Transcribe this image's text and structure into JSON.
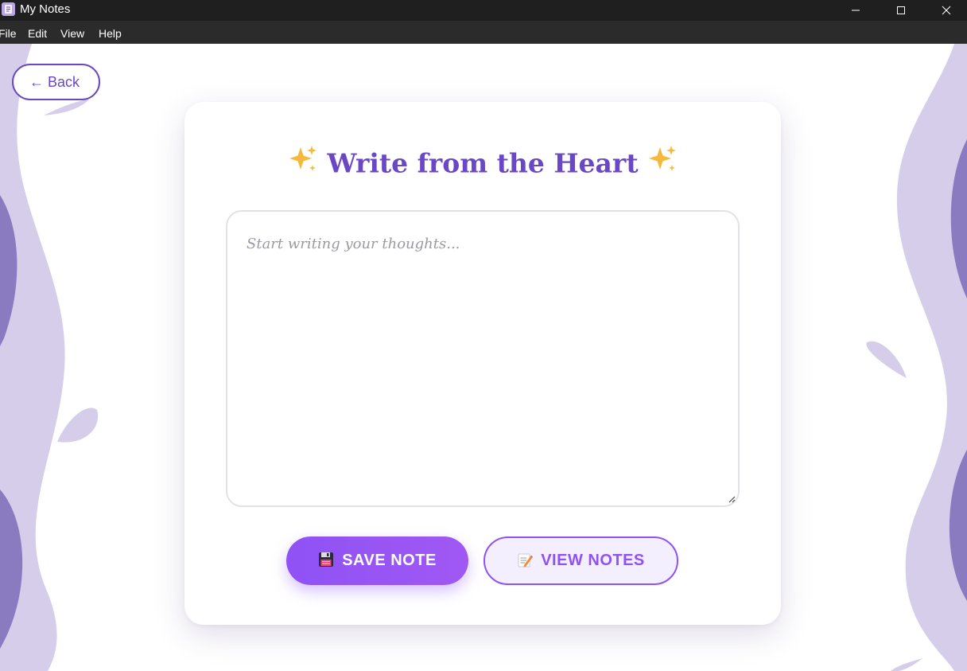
{
  "window": {
    "title": "My Notes",
    "icon": "notes-app-icon"
  },
  "menu": {
    "items": [
      {
        "label": "File"
      },
      {
        "label": "Edit"
      },
      {
        "label": "View"
      },
      {
        "label": "Help"
      }
    ]
  },
  "nav": {
    "back_label": "← Back"
  },
  "editor": {
    "title": "Write from the Heart",
    "title_icon": "sparkles-icon",
    "placeholder": "Start writing your thoughts...",
    "value": ""
  },
  "actions": {
    "save_label": "SAVE NOTE",
    "save_icon": "floppy-disk-icon",
    "view_label": "VIEW NOTES",
    "view_icon": "memo-icon"
  },
  "colors": {
    "accent": "#6a47c4",
    "button_gradient_start": "#8f52f5",
    "button_gradient_end": "#a058f3",
    "background_wave_light": "#d6cdea",
    "background_wave_dark": "#8a7bc0"
  }
}
